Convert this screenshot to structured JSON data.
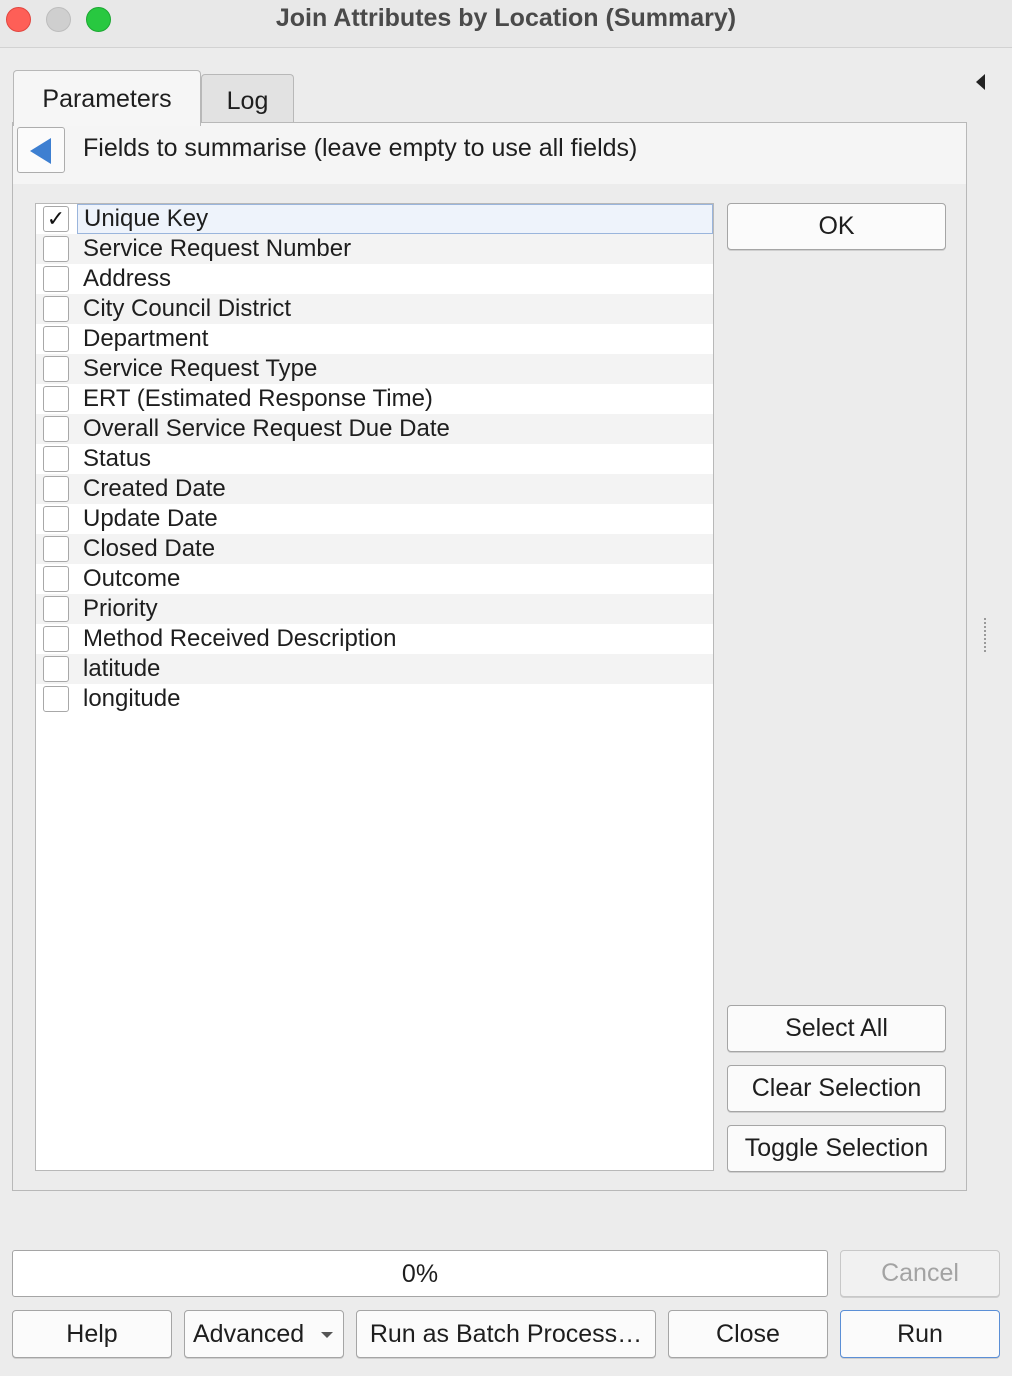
{
  "window": {
    "title": "Join Attributes by Location (Summary)"
  },
  "tabs": [
    {
      "label": "Parameters",
      "active": true
    },
    {
      "label": "Log",
      "active": false
    }
  ],
  "panel": {
    "title": "Fields to summarise (leave empty to use all fields)"
  },
  "fields": [
    {
      "label": "Unique Key",
      "checked": true,
      "selected": true
    },
    {
      "label": "Service Request Number",
      "checked": false
    },
    {
      "label": "Address",
      "checked": false
    },
    {
      "label": "City Council District",
      "checked": false
    },
    {
      "label": "Department",
      "checked": false
    },
    {
      "label": "Service Request Type",
      "checked": false
    },
    {
      "label": "ERT (Estimated Response Time)",
      "checked": false
    },
    {
      "label": "Overall Service Request Due Date",
      "checked": false
    },
    {
      "label": "Status",
      "checked": false
    },
    {
      "label": "Created Date",
      "checked": false
    },
    {
      "label": "Update Date",
      "checked": false
    },
    {
      "label": "Closed Date",
      "checked": false
    },
    {
      "label": "Outcome",
      "checked": false
    },
    {
      "label": "Priority",
      "checked": false
    },
    {
      "label": "Method Received Description",
      "checked": false
    },
    {
      "label": "latitude",
      "checked": false
    },
    {
      "label": "longitude",
      "checked": false
    }
  ],
  "side_buttons": {
    "ok": "OK",
    "select_all": "Select All",
    "clear_selection": "Clear Selection",
    "toggle_selection": "Toggle Selection"
  },
  "progress": {
    "label": "0%",
    "value": 0
  },
  "buttons": {
    "cancel": "Cancel",
    "help": "Help",
    "advanced": "Advanced",
    "batch": "Run as Batch Process…",
    "close": "Close",
    "run": "Run"
  },
  "colors": {
    "accent": "#3d7fd1",
    "close_light": "#fe5f57",
    "max_light": "#28c840"
  }
}
